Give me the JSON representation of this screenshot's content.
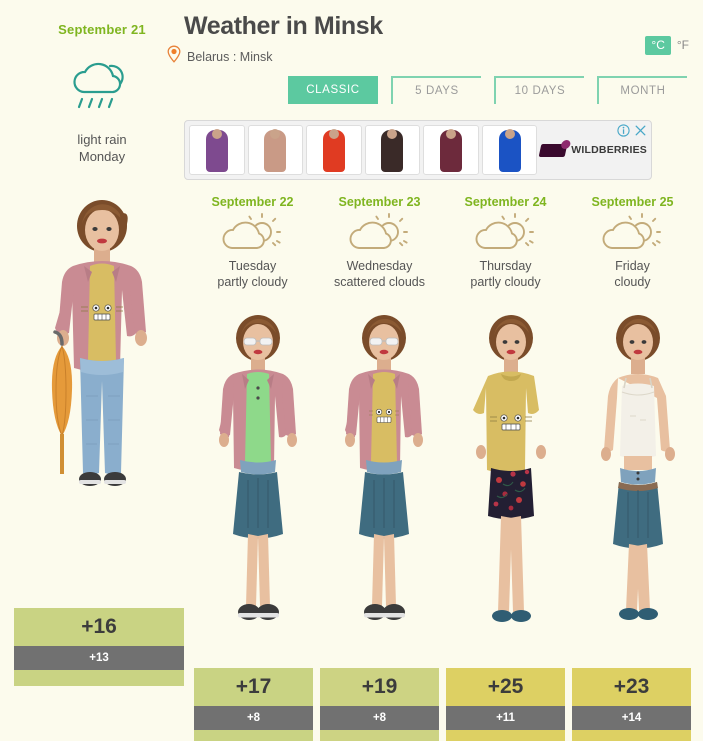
{
  "background_color": "#fcfbed",
  "accent_green": "#7fb520",
  "accent_teal": "#5cc9a0",
  "header": {
    "title": "Weather in Minsk",
    "location": "Belarus : Minsk",
    "location_pin_icon": "map-pin-icon",
    "today_date": "September 21",
    "today_icon": "rain-cloud-icon",
    "today_condition": "light rain",
    "today_day": "Monday",
    "units": {
      "celsius": "°C",
      "fahrenheit": "°F",
      "active": "°C"
    }
  },
  "tabs": [
    {
      "label": "CLASSIC",
      "active": true
    },
    {
      "label": "5 DAYS",
      "active": false
    },
    {
      "label": "10 DAYS",
      "active": false
    },
    {
      "label": "MONTH",
      "active": false
    }
  ],
  "ad": {
    "brand": "WILDBERRIES",
    "logo_icon": "wildberries-logo-icon",
    "info_icon": "info-icon",
    "close_icon": "close-icon",
    "thumbs": [
      {
        "name": "purple-lingerie-dress",
        "color": "#7e4a8f"
      },
      {
        "name": "two-models-underwear",
        "color": "#c99a86"
      },
      {
        "name": "red-mens-jacket",
        "color": "#e03b22"
      },
      {
        "name": "patterned-black-top",
        "color": "#3a2a28"
      },
      {
        "name": "burgundy-tracksuit",
        "color": "#6d2a3c"
      },
      {
        "name": "blue-dress",
        "color": "#1b53c4"
      }
    ]
  },
  "today": {
    "date": "September 21",
    "condition": "light rain",
    "day": "Monday",
    "temp_high": "+16",
    "temp_low": "+13",
    "bar_color": "#c9d383",
    "outfit": {
      "name": "pink-jacket-jeans-umbrella-outfit",
      "jacket": "#c98b93",
      "shirt": "#d8bd63",
      "pants": "#8aaecd",
      "shoes": "#3b3b3b",
      "umbrella": "#e59a3a",
      "hair": "#8b5a33"
    }
  },
  "forecast": [
    {
      "date": "September 22",
      "day": "Tuesday",
      "condition": "partly cloudy",
      "icon": "sun-behind-cloud-icon",
      "temp_high": "+17",
      "temp_low": "+8",
      "bar_color": "#c9d383",
      "outfit": {
        "name": "pink-jacket-green-top-teal-skirt-outfit",
        "jacket": "#c98b93",
        "shirt": "#8ed98a",
        "skirt": "#3f6c80",
        "shoes": "#3b3b3b",
        "hair": "#8b5a33",
        "sunglasses": true
      }
    },
    {
      "date": "September 23",
      "day": "Wednesday",
      "condition": "scattered clouds",
      "icon": "sun-behind-cloud-icon",
      "temp_high": "+19",
      "temp_low": "+8",
      "bar_color": "#cdd383",
      "outfit": {
        "name": "pink-jacket-yellow-tee-teal-skirt-outfit",
        "jacket": "#c98b93",
        "shirt": "#d8bd63",
        "skirt": "#3f6c80",
        "shoes": "#3b3b3b",
        "hair": "#8b5a33",
        "sunglasses": true
      }
    },
    {
      "date": "September 24",
      "day": "Thursday",
      "condition": "partly cloudy",
      "icon": "sun-behind-cloud-icon",
      "temp_high": "+25",
      "temp_low": "+11",
      "bar_color": "#ddd063",
      "outfit": {
        "name": "yellow-tee-floral-skirt-outfit",
        "shirt": "#d8bd63",
        "skirt": "#231f33",
        "shoes": "#2f5d73",
        "hair": "#8b5a33",
        "sunglasses": false
      }
    },
    {
      "date": "September 25",
      "day": "Friday",
      "condition": "cloudy",
      "icon": "sun-behind-cloud-icon",
      "temp_high": "+23",
      "temp_low": "+14",
      "bar_color": "#ddd063",
      "outfit": {
        "name": "white-camisole-teal-skirt-outfit",
        "shirt": "#f3f0e8",
        "skirt": "#3f6c80",
        "shoes": "#2f5d73",
        "hair": "#8b5a33",
        "sunglasses": false
      }
    }
  ]
}
